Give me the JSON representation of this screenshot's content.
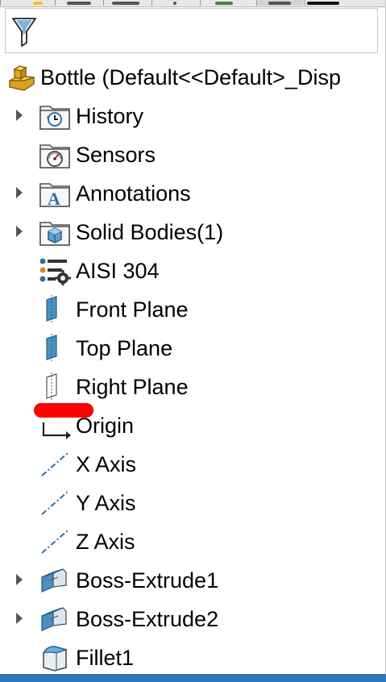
{
  "colors": {
    "background": "#ffffff",
    "folder_blue": "#5aa3d1",
    "plane_blue": "#4a90c2",
    "axis_blue": "#2f6ea6",
    "part_yellow": "#f2c12e",
    "highlight_red": "#ff0000",
    "bottom_bar": "#3376b7"
  },
  "filter": {
    "icon": "filter-icon"
  },
  "root": {
    "icon": "part-icon",
    "label": "Bottle  (Default<<Default>_Disp"
  },
  "tree": [
    {
      "label": "History",
      "icon": "history-folder-icon",
      "expandable": true
    },
    {
      "label": "Sensors",
      "icon": "sensors-folder-icon",
      "expandable": false
    },
    {
      "label": "Annotations",
      "icon": "annotations-folder-icon",
      "expandable": true
    },
    {
      "label": "Solid Bodies(1)",
      "icon": "solid-bodies-folder-icon",
      "expandable": true
    },
    {
      "label": "AISI 304",
      "icon": "material-icon",
      "expandable": false
    },
    {
      "label": "Front Plane",
      "icon": "plane-icon",
      "expandable": false
    },
    {
      "label": "Top Plane",
      "icon": "plane-icon",
      "expandable": false
    },
    {
      "label": "Right Plane",
      "icon": "plane-hidden-icon",
      "expandable": false
    },
    {
      "label": "Origin",
      "icon": "origin-icon",
      "expandable": false
    },
    {
      "label": "X Axis",
      "icon": "axis-icon",
      "expandable": false
    },
    {
      "label": "Y Axis",
      "icon": "axis-icon",
      "expandable": false
    },
    {
      "label": "Z Axis",
      "icon": "axis-icon",
      "expandable": false
    },
    {
      "label": "Boss-Extrude1",
      "icon": "boss-extrude-icon",
      "expandable": true
    },
    {
      "label": "Boss-Extrude2",
      "icon": "boss-extrude-icon",
      "expandable": true
    },
    {
      "label": "Fillet1",
      "icon": "fillet-icon",
      "expandable": false
    }
  ]
}
